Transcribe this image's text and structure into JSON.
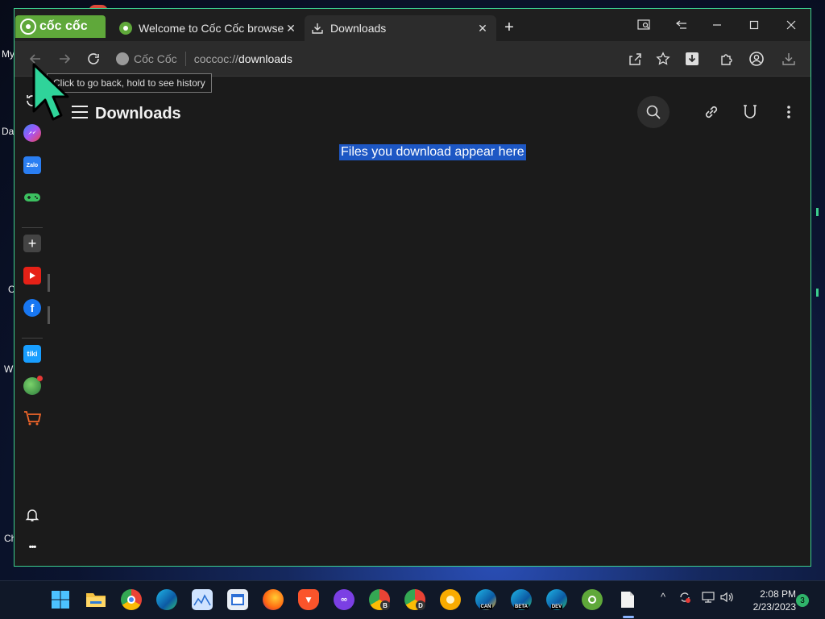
{
  "desktop": {
    "labels": [
      "My",
      "Da",
      "C",
      "W",
      "Ch"
    ]
  },
  "browser": {
    "brand_text": "cốc cốc",
    "tabs": [
      {
        "title": "Welcome to Cốc Cốc browser",
        "close": "✕"
      },
      {
        "title": "Downloads",
        "close": "✕"
      }
    ],
    "new_tab": "+",
    "toolbar": {
      "site_chip": "Cốc Cốc",
      "url_prefix": "coccoc://",
      "url_path": "downloads",
      "tooltip": "Click to go back, hold to see history"
    }
  },
  "page": {
    "title": "Downloads",
    "empty_message": "Files you download appear here"
  },
  "sidebar": {
    "items": [
      {
        "name": "history",
        "label": ""
      },
      {
        "name": "messenger",
        "label": ""
      },
      {
        "name": "zalo",
        "label": "Zalo"
      },
      {
        "name": "games",
        "label": ""
      },
      {
        "name": "add",
        "label": "+"
      },
      {
        "name": "youtube",
        "label": ""
      },
      {
        "name": "facebook",
        "label": "f"
      },
      {
        "name": "tiki",
        "label": "tiki"
      },
      {
        "name": "earth",
        "label": ""
      },
      {
        "name": "shop",
        "label": ""
      },
      {
        "name": "notifications",
        "label": ""
      },
      {
        "name": "more",
        "label": "•••"
      }
    ]
  },
  "taskbar": {
    "apps": [
      "windows",
      "explorer",
      "chrome",
      "edge",
      "photos",
      "notepad",
      "firefox",
      "brave",
      "tor",
      "chrome-b",
      "chrome-d",
      "chrome-canary",
      "edge-canary",
      "edge-beta",
      "edge-dev",
      "coccoc",
      "file"
    ],
    "app_badges": {
      "edge-canary": "CAN",
      "edge-beta": "BETA",
      "edge-dev": "DEV",
      "chrome-b": "B",
      "chrome-d": "D"
    },
    "time": "2:08 PM",
    "date": "2/23/2023",
    "notification_count": "3"
  },
  "colors": {
    "accent": "#3ccf8e",
    "brand_green": "#5fa83a",
    "selection_blue": "#1d57c4"
  }
}
